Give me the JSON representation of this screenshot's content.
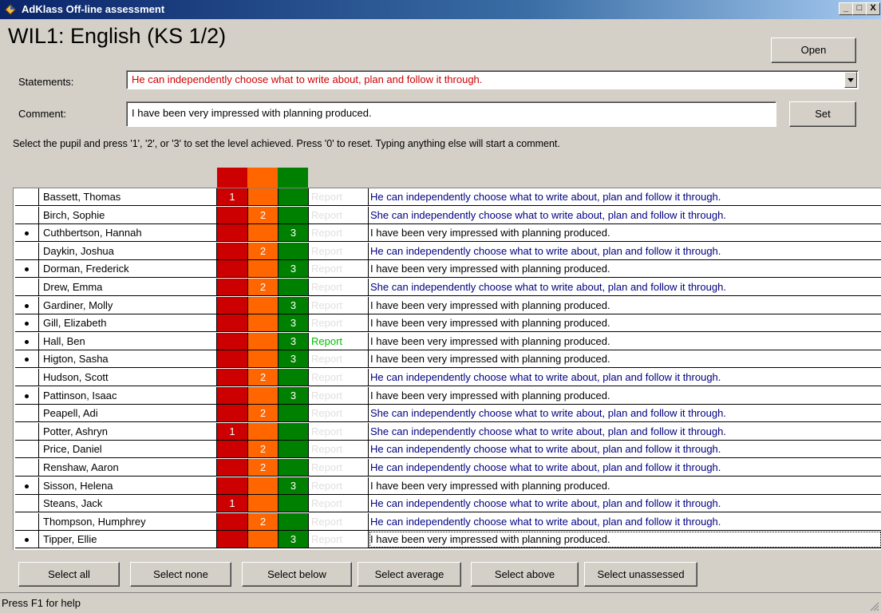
{
  "window": {
    "title": "AdKlass Off-line assessment",
    "minimize": "_",
    "maximize": "□",
    "close": "X"
  },
  "page_title": "WIL1: English (KS 1/2)",
  "open_button": "Open",
  "statements": {
    "label": "Statements:",
    "value": "He can independently choose what to write about, plan and follow it through.",
    "value_color": "#cc0000"
  },
  "comment": {
    "label": "Comment:",
    "value": "I have been very impressed with planning produced."
  },
  "set_button": "Set",
  "instructions": "Select the pupil and press '1', '2', or '3' to set the level achieved.  Press '0' to reset.  Typing anything else will start a comment.",
  "level_colors": {
    "1": "#cc0000",
    "2": "#ff6600",
    "3": "#008000"
  },
  "report_label": "Report",
  "pupils": [
    {
      "name": "Bassett, Thomas",
      "level": "1",
      "dot": false,
      "report": false,
      "comment": "He can independently choose what to write about, plan and follow it through.",
      "is_statement": true
    },
    {
      "name": "Birch, Sophie",
      "level": "2",
      "dot": false,
      "report": false,
      "comment": "She can independently choose what to write about, plan and follow it through.",
      "is_statement": true
    },
    {
      "name": "Cuthbertson, Hannah",
      "level": "3",
      "dot": true,
      "report": false,
      "comment": "I have been very impressed with planning produced.",
      "is_statement": false
    },
    {
      "name": "Daykin, Joshua",
      "level": "2",
      "dot": false,
      "report": false,
      "comment": "He can independently choose what to write about, plan and follow it through.",
      "is_statement": true
    },
    {
      "name": "Dorman, Frederick",
      "level": "3",
      "dot": true,
      "report": false,
      "comment": "I have been very impressed with planning produced.",
      "is_statement": false
    },
    {
      "name": "Drew, Emma",
      "level": "2",
      "dot": false,
      "report": false,
      "comment": "She can independently choose what to write about, plan and follow it through.",
      "is_statement": true
    },
    {
      "name": "Gardiner, Molly",
      "level": "3",
      "dot": true,
      "report": false,
      "comment": "I have been very impressed with planning produced.",
      "is_statement": false
    },
    {
      "name": "Gill, Elizabeth",
      "level": "3",
      "dot": true,
      "report": false,
      "comment": "I have been very impressed with planning produced.",
      "is_statement": false
    },
    {
      "name": "Hall, Ben",
      "level": "3",
      "dot": true,
      "report": true,
      "comment": "I have been very impressed with planning produced.",
      "is_statement": false
    },
    {
      "name": "Higton, Sasha",
      "level": "3",
      "dot": true,
      "report": false,
      "comment": "I have been very impressed with planning produced.",
      "is_statement": false
    },
    {
      "name": "Hudson, Scott",
      "level": "2",
      "dot": false,
      "report": false,
      "comment": "He can independently choose what to write about, plan and follow it through.",
      "is_statement": true
    },
    {
      "name": "Pattinson, Isaac",
      "level": "3",
      "dot": true,
      "report": false,
      "comment": "I have been very impressed with planning produced.",
      "is_statement": false
    },
    {
      "name": "Peapell, Adi",
      "level": "2",
      "dot": false,
      "report": false,
      "comment": "She can independently choose what to write about, plan and follow it through.",
      "is_statement": true
    },
    {
      "name": "Potter, Ashryn",
      "level": "1",
      "dot": false,
      "report": false,
      "comment": "She can independently choose what to write about, plan and follow it through.",
      "is_statement": true
    },
    {
      "name": "Price, Daniel",
      "level": "2",
      "dot": false,
      "report": false,
      "comment": "He can independently choose what to write about, plan and follow it through.",
      "is_statement": true
    },
    {
      "name": "Renshaw, Aaron",
      "level": "2",
      "dot": false,
      "report": false,
      "comment": "He can independently choose what to write about, plan and follow it through.",
      "is_statement": true
    },
    {
      "name": "Sisson, Helena",
      "level": "3",
      "dot": true,
      "report": false,
      "comment": "I have been very impressed with planning produced.",
      "is_statement": false
    },
    {
      "name": "Steans, Jack",
      "level": "1",
      "dot": false,
      "report": false,
      "comment": "He can independently choose what to write about, plan and follow it through.",
      "is_statement": true
    },
    {
      "name": "Thompson, Humphrey",
      "level": "2",
      "dot": false,
      "report": false,
      "comment": "He can independently choose what to write about, plan and follow it through.",
      "is_statement": true
    },
    {
      "name": "Tipper, Ellie",
      "level": "3",
      "dot": true,
      "report": false,
      "comment": "I have been very impressed with planning produced.",
      "is_statement": false,
      "focused": true
    }
  ],
  "buttons": {
    "select_all": "Select all",
    "select_none": "Select none",
    "select_below": "Select below",
    "select_average": "Select average",
    "select_above": "Select above",
    "select_unassessed": "Select unassessed"
  },
  "status": "Press F1 for help"
}
